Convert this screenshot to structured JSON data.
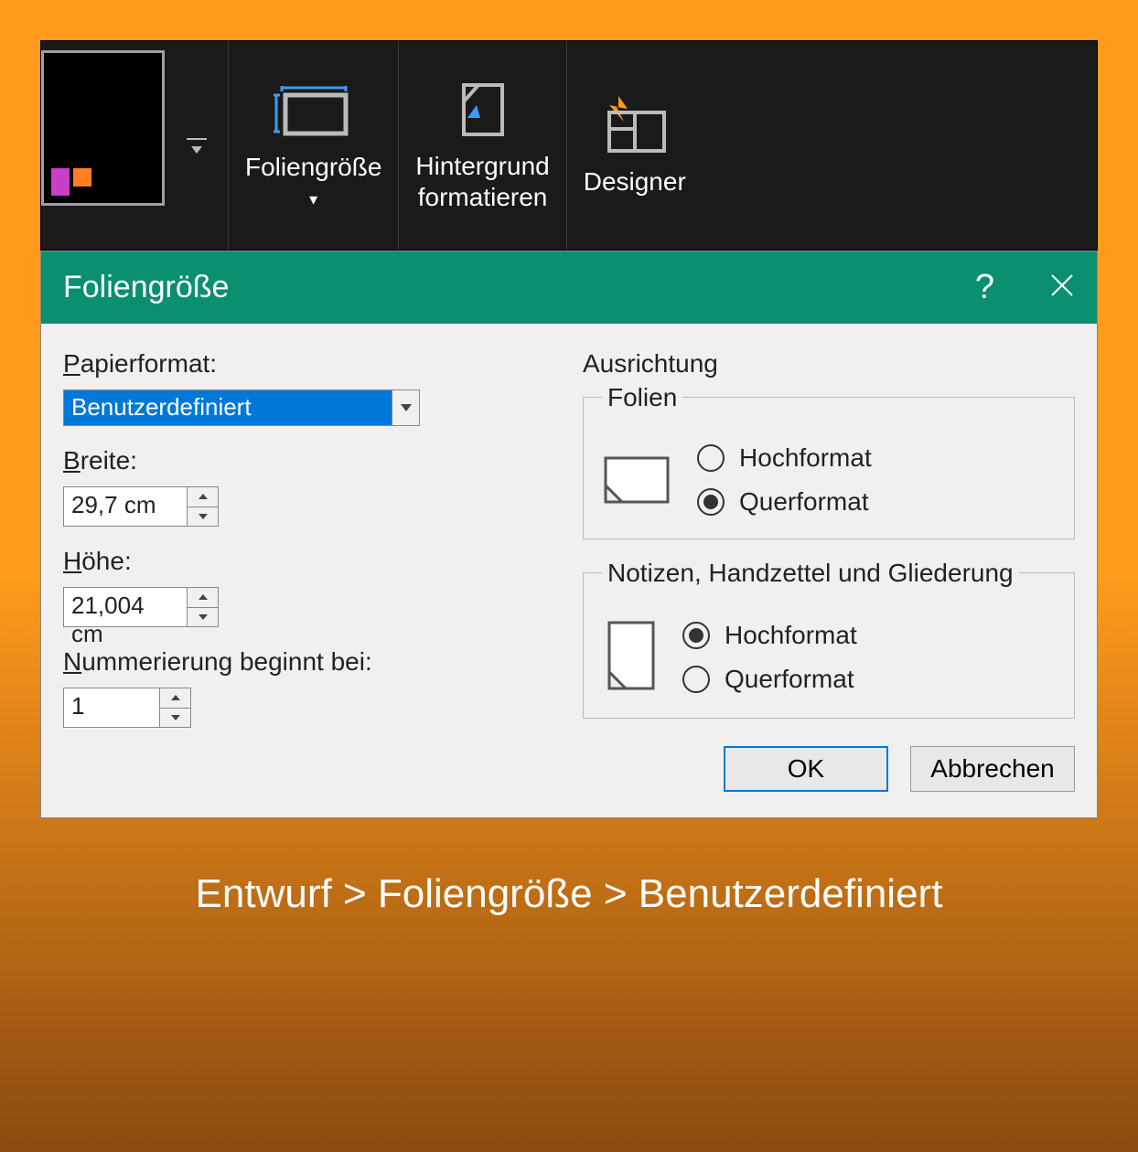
{
  "ribbon": {
    "slide_size_label": "Foliengröße",
    "background_label_line1": "Hintergrund",
    "background_label_line2": "formatieren",
    "designer_label": "Designer"
  },
  "dialog": {
    "title": "Foliengröße",
    "help_symbol": "?",
    "paper_format_label": "Papierformat:",
    "paper_format_value": "Benutzerdefiniert",
    "width_label": "Breite:",
    "width_value": "29,7 cm",
    "height_label": "Höhe:",
    "height_value": "21,004 cm",
    "numbering_label": "Nummerierung beginnt bei:",
    "numbering_value": "1",
    "orientation_label": "Ausrichtung",
    "slides_label": "Folien",
    "portrait_label": "Hochformat",
    "landscape_label": "Querformat",
    "notes_label": "Notizen, Handzettel und Gliederung",
    "ok_label": "OK",
    "cancel_label": "Abbrechen"
  },
  "breadcrumb": "Entwurf > Foliengröße > Benutzerdefiniert"
}
